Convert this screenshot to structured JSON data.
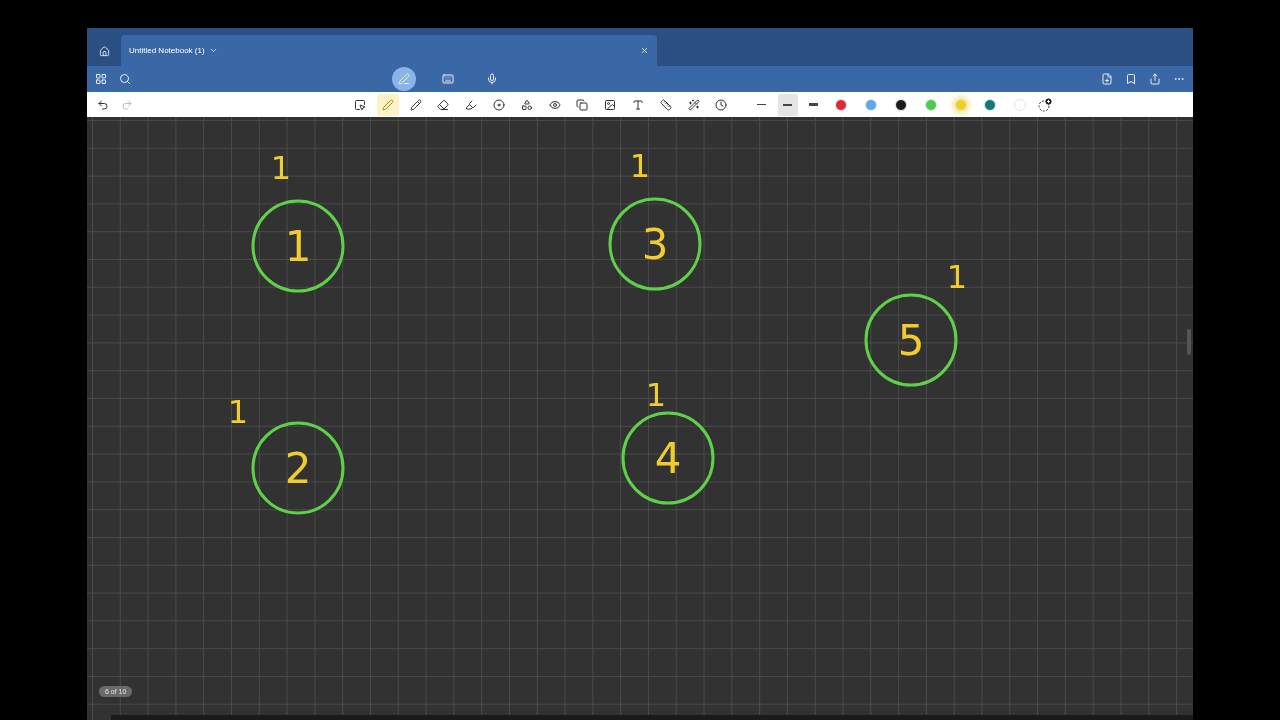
{
  "tab": {
    "title": "Untitled Notebook (1)"
  },
  "app_modes": [
    {
      "selected": true
    },
    {
      "selected": false
    },
    {
      "selected": false
    }
  ],
  "tools": [
    {
      "selected": false
    },
    {
      "selected": true
    },
    {
      "selected": false
    },
    {
      "selected": false
    },
    {
      "selected": false
    },
    {
      "selected": false
    },
    {
      "selected": false
    },
    {
      "selected": false
    },
    {
      "selected": false
    },
    {
      "selected": false
    },
    {
      "selected": false
    },
    {
      "selected": false
    },
    {
      "selected": false
    },
    {
      "selected": false
    }
  ],
  "stroke_widths": [
    {
      "selected": false
    },
    {
      "selected": true
    },
    {
      "selected": false
    }
  ],
  "colors": [
    {
      "color": "#e0283a",
      "selected": false
    },
    {
      "color": "#5aa9ec",
      "selected": false
    },
    {
      "color": "#1a1a1a",
      "selected": false
    },
    {
      "color": "#4ccb4c",
      "selected": false
    },
    {
      "color": "#f2d023",
      "selected": true
    },
    {
      "color": "#0e7b7b",
      "selected": false
    },
    {
      "color": "#ffffff",
      "selected": false
    }
  ],
  "nodes": [
    {
      "label": "1",
      "mark": "1"
    },
    {
      "label": "2",
      "mark": "1"
    },
    {
      "label": "3",
      "mark": "1"
    },
    {
      "label": "4",
      "mark": "1"
    },
    {
      "label": "5",
      "mark": "1"
    }
  ],
  "page_indicator": "6 of 10"
}
